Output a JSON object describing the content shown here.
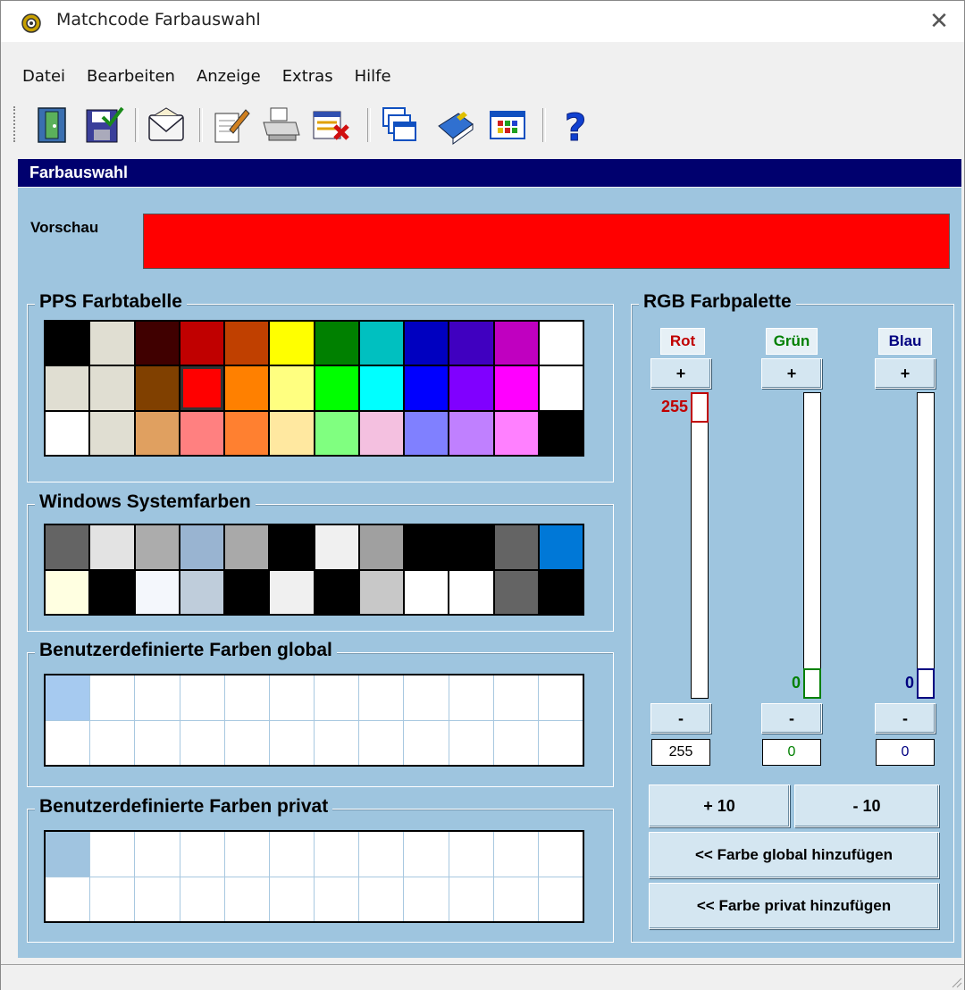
{
  "window": {
    "title": "Matchcode Farbauswahl",
    "close_glyph": "✕"
  },
  "menu": [
    "Datei",
    "Bearbeiten",
    "Anzeige",
    "Extras",
    "Hilfe"
  ],
  "toolbar_icons": [
    "exit-door-icon",
    "save-disk-icon",
    "email-envelope-icon",
    "edit-document-icon",
    "print-icon",
    "delete-list-icon",
    "windows-stack-icon",
    "book-icon",
    "grid-table-icon",
    "help-question-icon"
  ],
  "section_header": "Farbauswahl",
  "preview": {
    "label": "Vorschau",
    "color": "#ff0000"
  },
  "pps": {
    "title": "PPS Farbtabelle",
    "colors": [
      "#000000",
      "#e0ded2",
      "#400000",
      "#c00000",
      "#c04000",
      "#ffff00",
      "#008000",
      "#00c0c0",
      "#0000c0",
      "#4000c0",
      "#c000c0",
      "#ffffff",
      "#e0ded2",
      "#e0ded2",
      "#804000",
      "#ff0000",
      "#ff8000",
      "#ffff80",
      "#00ff00",
      "#00ffff",
      "#0000ff",
      "#8000ff",
      "#ff00ff",
      "#ffffff",
      "#ffffff",
      "#e0ded2",
      "#e0a060",
      "#ff8080",
      "#ff8030",
      "#ffe8a0",
      "#80ff80",
      "#f4c0e0",
      "#8080ff",
      "#c080ff",
      "#ff80ff",
      "#000000"
    ]
  },
  "system": {
    "title": "Windows Systemfarben",
    "colors": [
      "#646464",
      "#e3e3e3",
      "#acacac",
      "#99b4d1",
      "#a9a9a9",
      "#000000",
      "#f0f0f0",
      "#a0a0a0",
      "#000000",
      "#000000",
      "#646464",
      "#0078d7",
      "#ffffe1",
      "#000000",
      "#f4f7fc",
      "#bfcddb",
      "#000000",
      "#f0f0f0",
      "#000000",
      "#c8c8c8",
      "#ffffff",
      "#ffffff",
      "#646464",
      "#000000"
    ]
  },
  "custom_global": {
    "title": "Benutzerdefinierte Farben global",
    "first_color": "#a6caf0"
  },
  "custom_private": {
    "title": "Benutzerdefinierte Farben privat",
    "first_color": "#a0c4e0"
  },
  "rgb": {
    "title": "RGB Farbpalette",
    "plus": "+",
    "minus": "-",
    "channels": [
      {
        "name": "Rot",
        "value": "255",
        "level": 1.0,
        "color": "#c00000"
      },
      {
        "name": "Grün",
        "value": "0",
        "level": 0.0,
        "color": "#008000"
      },
      {
        "name": "Blau",
        "value": "0",
        "level": 0.0,
        "color": "#000080"
      }
    ],
    "plus10": "+ 10",
    "minus10": "- 10",
    "add_global": "<< Farbe global hinzufügen",
    "add_private": "<< Farbe privat hinzufügen"
  }
}
